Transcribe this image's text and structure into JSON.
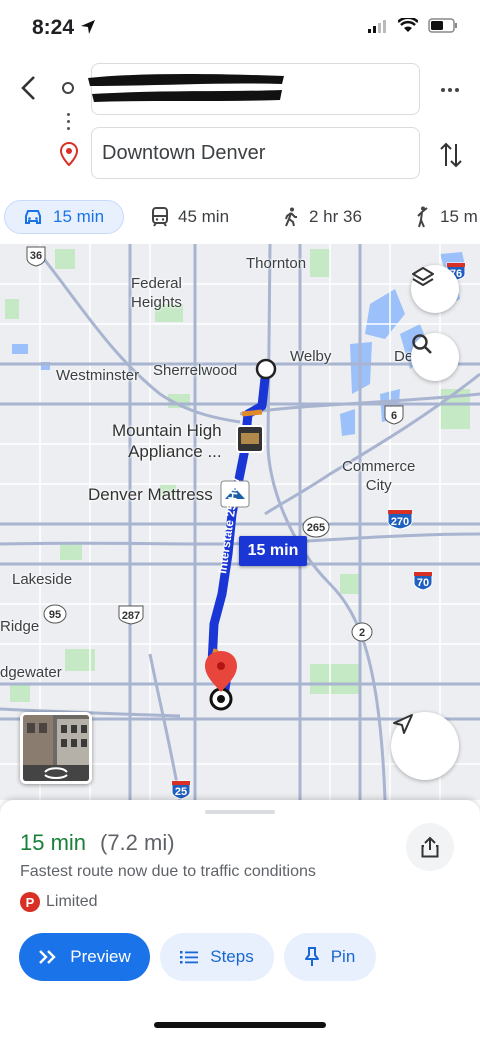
{
  "status": {
    "time": "8:24"
  },
  "search": {
    "origin": "",
    "destination": "Downtown Denver"
  },
  "modes": [
    {
      "name": "drive",
      "label": "15 min",
      "active": true
    },
    {
      "name": "transit",
      "label": "45 min"
    },
    {
      "name": "walk",
      "label": "2 hr 36"
    },
    {
      "name": "ride",
      "label": "15 m"
    }
  ],
  "map": {
    "labels": {
      "thornton": "Thornton",
      "federal_heights": "Federal\nHeights",
      "welby": "Welby",
      "de": "De",
      "westminster": "Westminster",
      "sherrelwood": "Sherrelwood",
      "mountain_high": "Mountain High\nAppliance ...",
      "commerce_city": "Commerce\nCity",
      "denver_mattress": "Denver Mattress",
      "lakeside": "Lakeside",
      "ridge": "Ridge",
      "edgewater": "dgewater",
      "interstate": "Interstate 25 Hov"
    },
    "shields": {
      "us36": "36",
      "i76": "76",
      "s6": "6",
      "s265": "265",
      "i270": "270",
      "i70": "70",
      "s95": "95",
      "us287": "287",
      "s2": "2",
      "i25": "25"
    },
    "route_badge": "15 min",
    "colors": {
      "route": "#1a37d6",
      "water": "#9cc0f9",
      "park": "#c5e8c5"
    }
  },
  "sheet": {
    "time": "15 min",
    "distance": "(7.2 mi)",
    "note": "Fastest route now due to traffic conditions",
    "parking_icon": "P",
    "parking": "Limited",
    "buttons": {
      "preview": "Preview",
      "steps": "Steps",
      "pin": "Pin"
    }
  }
}
